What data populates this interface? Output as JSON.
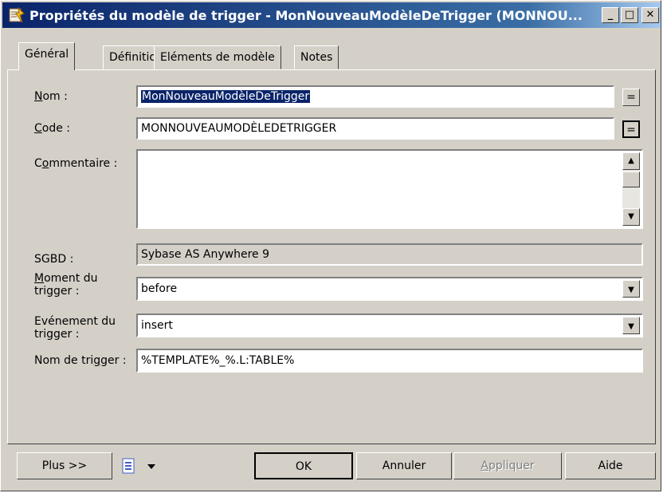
{
  "window": {
    "title": "Propriétés du modèle de trigger - MonNouveauModèleDeTrigger (MONNOU...",
    "minimize_icon": "minimize-icon",
    "maximize_icon": "maximize-icon",
    "close_icon": "close-icon"
  },
  "tabs": [
    {
      "label": "Général",
      "active": true
    },
    {
      "label": "Définition",
      "active": false
    },
    {
      "label": "Eléments de modèle",
      "active": false
    },
    {
      "label": "Notes",
      "active": false
    }
  ],
  "form": {
    "nom": {
      "label_u": "N",
      "label_rest": "om :",
      "value": "MonNouveauModèleDeTrigger",
      "btn": "="
    },
    "code": {
      "label_u": "C",
      "label_rest": "ode :",
      "value": "MONNOUVEAUMODÈLEDETRIGGER",
      "btn": "="
    },
    "commentaire": {
      "label_pre": "C",
      "label_u": "o",
      "label_rest": "mmentaire :",
      "value": ""
    },
    "sgbd": {
      "label": "SGBD :",
      "value": "Sybase AS Anywhere 9"
    },
    "moment": {
      "label_u": "M",
      "label_line1_rest": "oment du",
      "label_line2": "trigger :",
      "value": "before"
    },
    "evenement": {
      "label_line1": "Evénement du",
      "label_line2": "trigger :",
      "value": "insert"
    },
    "nom_trigger": {
      "label_pre": "Nom de tri",
      "label_u": "g",
      "label_rest": "ger :",
      "value": "%TEMPLATE%_%.L:TABLE%"
    }
  },
  "footer": {
    "plus": "Plus >>",
    "menu_icon": "list-menu-icon",
    "ok": "OK",
    "annuler": "Annuler",
    "appliquer_u": "A",
    "appliquer_rest": "ppliquer",
    "aide": "Aide"
  },
  "colors": {
    "title_start": "#0a246a",
    "title_end": "#a6caf0",
    "face": "#d4d0c8"
  }
}
